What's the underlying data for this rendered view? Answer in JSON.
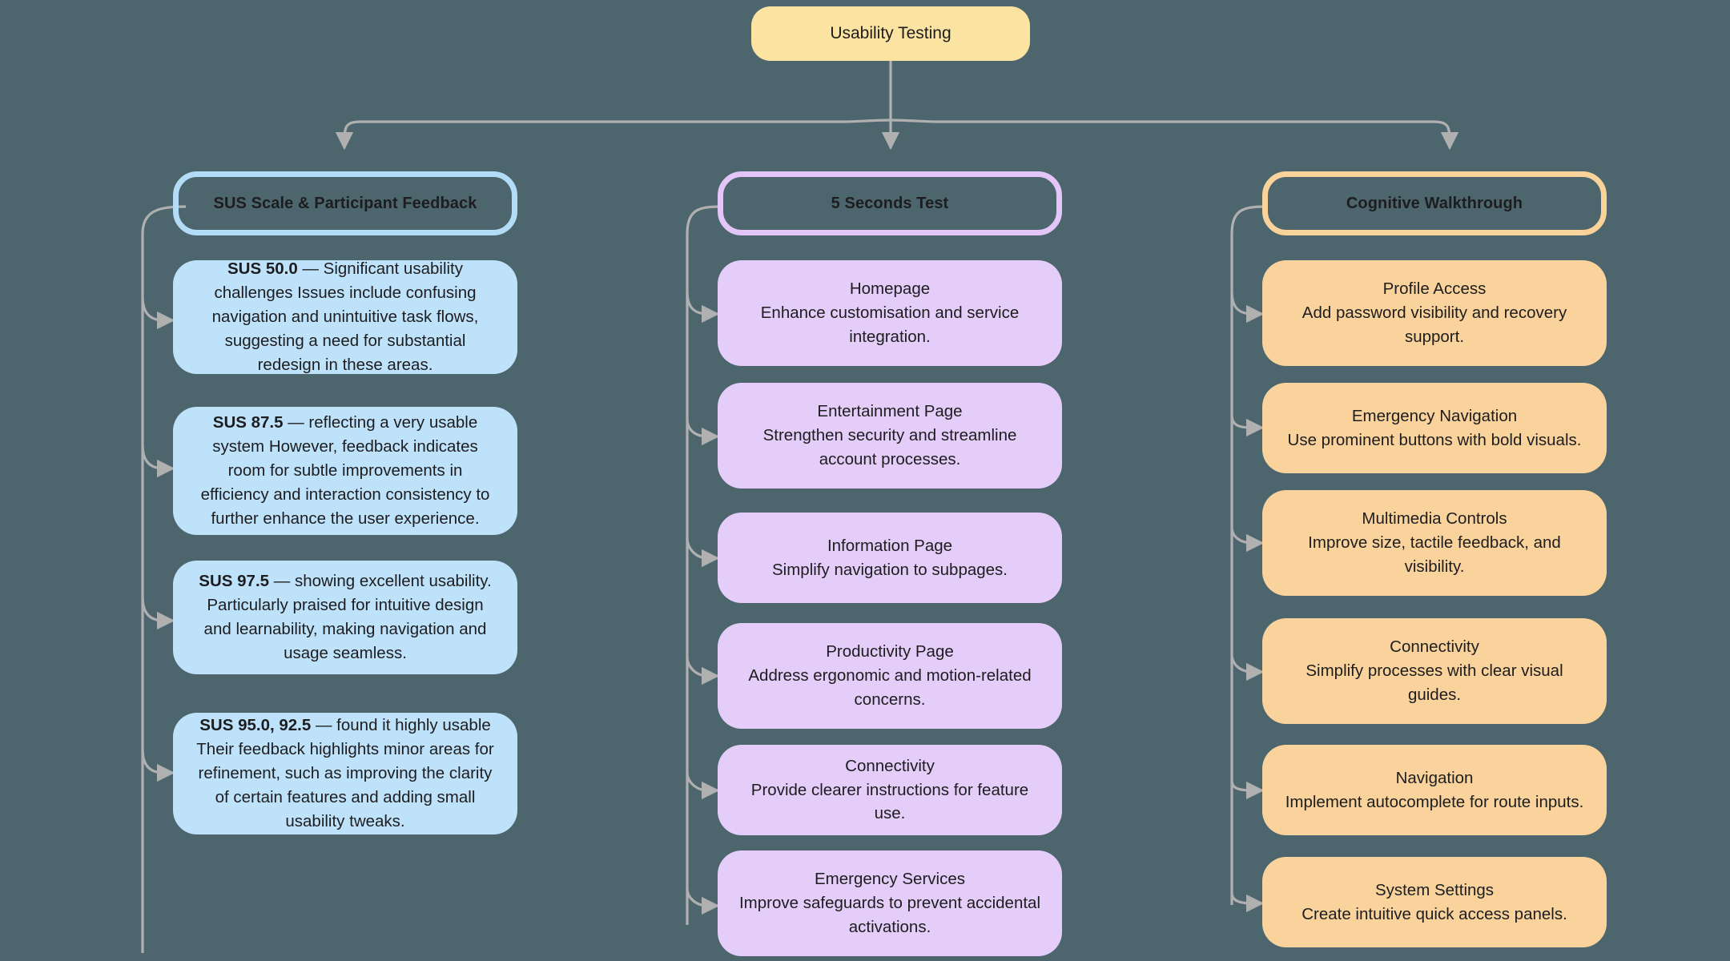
{
  "diagram": {
    "type": "tree-flowchart",
    "background_color": "#4d666e",
    "connector_color": "#b0b0b0",
    "root": {
      "label": "Usability Testing",
      "color": "#fbe3a1"
    },
    "branches": [
      {
        "header": "SUS Scale & Participant Feedback",
        "accent_color": "#b3ddf7",
        "card_color": "#bfe2fb",
        "cards": [
          {
            "bold": "SUS 50.0",
            "dash": " — ",
            "text": "Significant usability challenges Issues include confusing navigation and unintuitive task flows, suggesting a need for substantial redesign in these areas."
          },
          {
            "bold": "SUS 87.5",
            "dash": " — ",
            "text": "reflecting a very usable system However, feedback indicates room for subtle improvements in efficiency and interaction consistency to further enhance the user experience."
          },
          {
            "bold": "SUS 97.5",
            "dash": " — ",
            "text": "showing excellent usability. Particularly praised for intuitive design and learnability, making navigation and usage seamless."
          },
          {
            "bold": "SUS 95.0, 92.5",
            "dash": " — ",
            "text": "found it highly usable Their feedback highlights minor areas for refinement, such as improving the clarity of certain features and adding small usability tweaks."
          }
        ]
      },
      {
        "header": "5 Seconds Test",
        "accent_color": "#e3c6f7",
        "card_color": "#e5cdf9",
        "cards": [
          {
            "title": "Homepage",
            "text": "Enhance customisation and service integration."
          },
          {
            "title": "Entertainment Page",
            "text": "Strengthen security and streamline account processes."
          },
          {
            "title": "Information Page",
            "text": "Simplify navigation to subpages."
          },
          {
            "title": "Productivity Page",
            "text": "Address ergonomic and motion-related concerns."
          },
          {
            "title": "Connectivity",
            "text": "Provide clearer instructions for feature use."
          },
          {
            "title": "Emergency Services",
            "text": "Improve safeguards to prevent accidental activations."
          }
        ]
      },
      {
        "header": "Cognitive Walkthrough",
        "accent_color": "#fad39a",
        "card_color": "#fad39c",
        "cards": [
          {
            "title": "Profile Access",
            "text": "Add password visibility and recovery support."
          },
          {
            "title": "Emergency Navigation",
            "text": "Use prominent buttons with bold visuals."
          },
          {
            "title": "Multimedia Controls",
            "text": "Improve size, tactile feedback, and visibility."
          },
          {
            "title": "Connectivity",
            "text": "Simplify processes with clear visual guides."
          },
          {
            "title": "Navigation",
            "text": "Implement autocomplete for route inputs."
          },
          {
            "title": "System Settings",
            "text": "Create intuitive quick access panels."
          }
        ]
      }
    ]
  }
}
